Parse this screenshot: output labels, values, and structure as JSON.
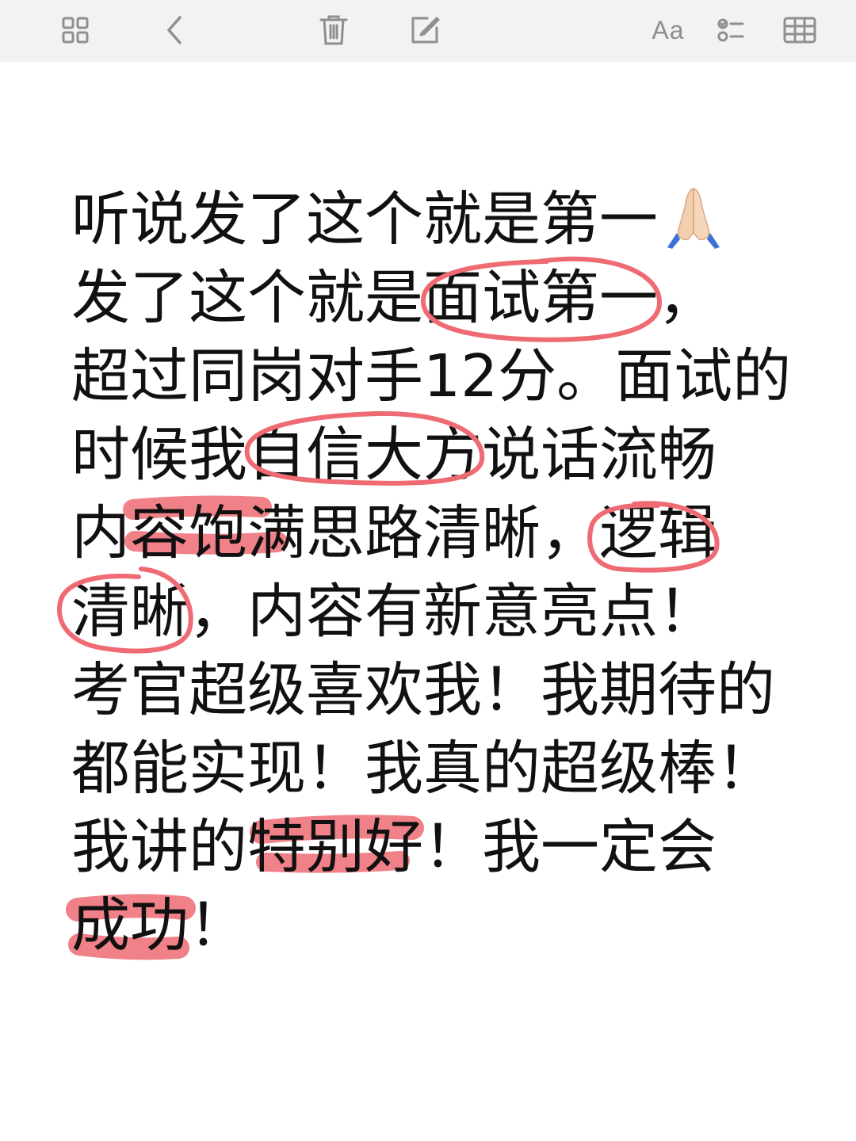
{
  "toolbar": {
    "icons": [
      "grid-icon",
      "back-chevron-icon",
      "trash-icon",
      "compose-icon",
      "font-icon",
      "checklist-icon",
      "table-icon"
    ],
    "font_label": "Aa"
  },
  "note": {
    "lines": [
      "听说发了这个就是第一",
      "发了这个就是面试第一，",
      "超过同岗对手12分。面试的",
      "时候我自信大方说话流畅",
      "内容饱满思路清晰，逻辑",
      "清晰，内容有新意亮点！",
      "考官超级喜欢我！我期待的",
      "都能实现！我真的超级棒！",
      "我讲的特别好！我一定会",
      "成功！"
    ],
    "emoji": "praying-hands-icon"
  },
  "colors": {
    "toolbar_bg": "#f2f2f2",
    "icon": "#8e8e93",
    "text": "#111111",
    "highlight": "#ef6b73"
  }
}
